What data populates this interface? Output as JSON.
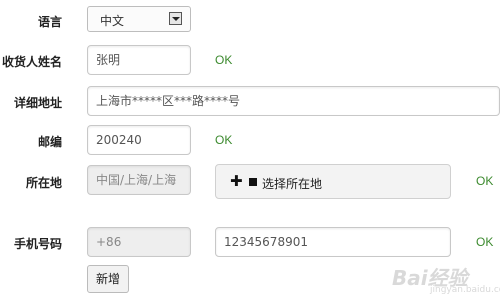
{
  "form": {
    "language": {
      "label": "语言",
      "selected": "中文"
    },
    "recipient_name": {
      "label": "收货人姓名",
      "value": "张明",
      "status": "OK"
    },
    "address": {
      "label": "详细地址",
      "value": "上海市*****区***路****号"
    },
    "postcode": {
      "label": "邮编",
      "value": "200240",
      "status": "OK"
    },
    "location": {
      "label": "所在地",
      "value": "中国/上海/上海",
      "picker_label": "选择所在地",
      "status": "OK"
    },
    "mobile": {
      "label": "手机号码",
      "country_code": "+86",
      "value": "12345678901",
      "status": "OK"
    },
    "add_button": "新增"
  },
  "watermark": {
    "brand": "Bai经验",
    "url": "jingyan.baidu.com"
  }
}
